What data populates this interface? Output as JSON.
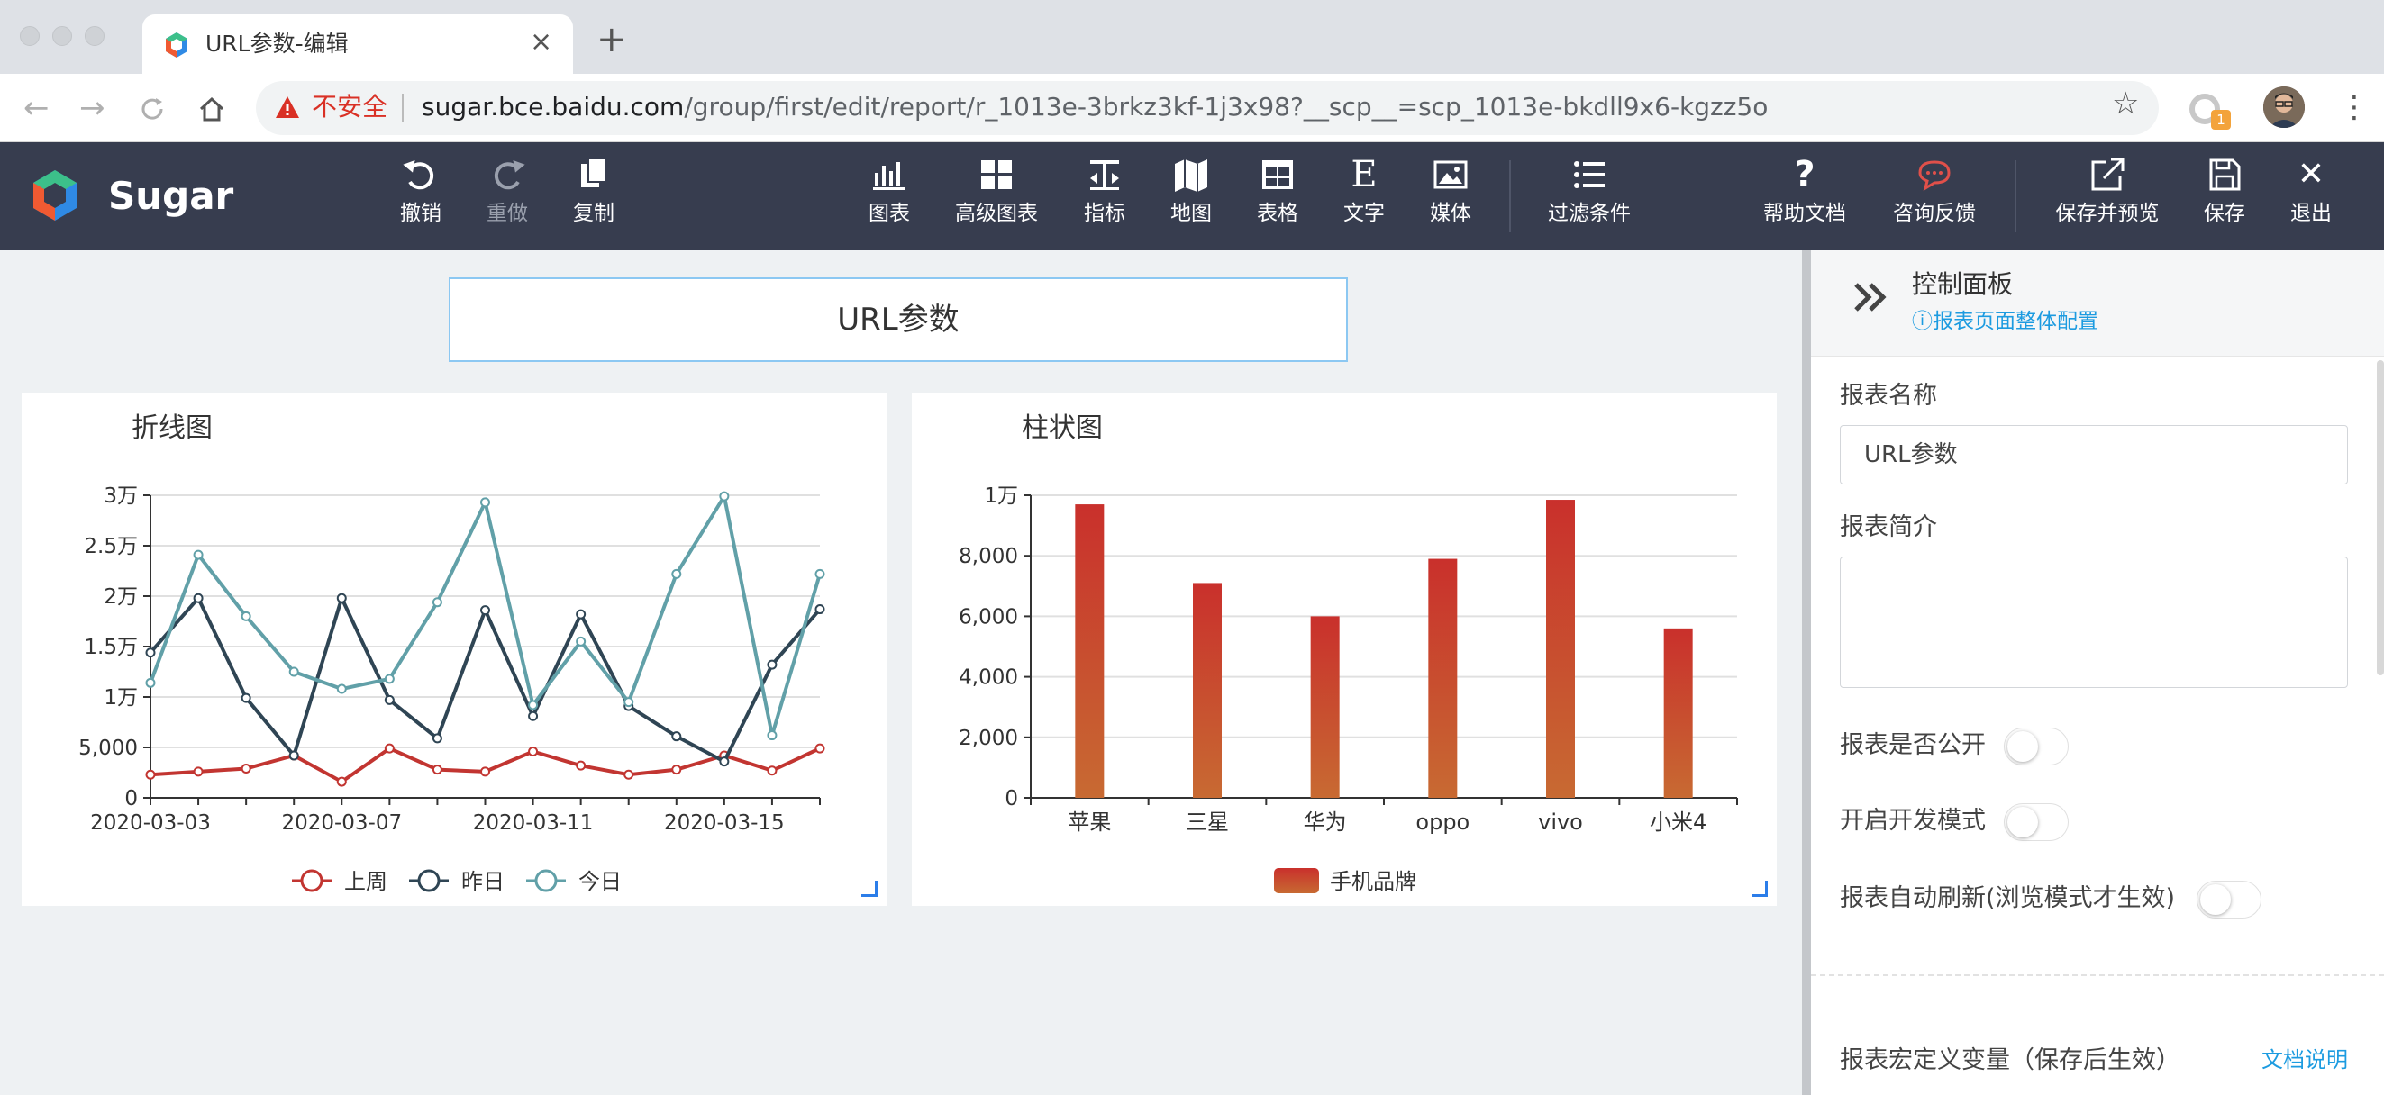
{
  "browser": {
    "tab_title": "URL参数-编辑",
    "new_tab": "+",
    "close": "×",
    "security_label": "不安全",
    "url_host": "sugar.bce.baidu.com",
    "url_path": "/group/first/edit/report/r_1013e-3brkz3kf-1j3x98?__scp__=scp_1013e-bkdll9x6-kgzz5o",
    "extension_badge": "1"
  },
  "app": {
    "brand": "Sugar",
    "tools_left": [
      {
        "label": "撤销",
        "icon": "undo-icon"
      },
      {
        "label": "重做",
        "icon": "redo-icon"
      },
      {
        "label": "复制",
        "icon": "copy-icon"
      }
    ],
    "tools_center": [
      {
        "label": "图表",
        "icon": "chart-icon"
      },
      {
        "label": "高级图表",
        "icon": "grid-chart-icon"
      },
      {
        "label": "指标",
        "icon": "metric-icon"
      },
      {
        "label": "地图",
        "icon": "map-icon"
      },
      {
        "label": "表格",
        "icon": "table-icon"
      },
      {
        "label": "文字",
        "icon": "text-icon",
        "glyph": "E"
      },
      {
        "label": "媒体",
        "icon": "image-icon"
      },
      {
        "label": "过滤条件",
        "icon": "filter-list-icon"
      }
    ],
    "tools_right": [
      {
        "label": "帮助文档",
        "icon": "help-icon",
        "glyph": "?"
      },
      {
        "label": "咨询反馈",
        "icon": "chat-icon"
      },
      {
        "label": "保存并预览",
        "icon": "external-link-icon"
      },
      {
        "label": "保存",
        "icon": "save-icon"
      },
      {
        "label": "退出",
        "icon": "close-icon",
        "glyph": "✕"
      }
    ]
  },
  "report": {
    "title": "URL参数"
  },
  "line_card": {
    "title": "折线图"
  },
  "bar_card": {
    "title": "柱状图"
  },
  "chart_data": [
    {
      "type": "line",
      "title": "折线图",
      "x": [
        "2020-03-03",
        "2020-03-04",
        "2020-03-05",
        "2020-03-06",
        "2020-03-07",
        "2020-03-08",
        "2020-03-09",
        "2020-03-10",
        "2020-03-11",
        "2020-03-12",
        "2020-03-13",
        "2020-03-14",
        "2020-03-15",
        "2020-03-16",
        "2020-03-17"
      ],
      "xtick_labels": [
        "2020-03-03",
        "2020-03-07",
        "2020-03-11",
        "2020-03-15"
      ],
      "ytick_labels": [
        "0",
        "5,000",
        "1万",
        "1.5万",
        "2万",
        "2.5万",
        "3万"
      ],
      "ylim": [
        0,
        30000
      ],
      "series": [
        {
          "name": "上周",
          "color": "#c23531",
          "values": [
            2300,
            2600,
            2900,
            4200,
            1600,
            4900,
            2800,
            2600,
            4600,
            3200,
            2300,
            2800,
            4200,
            2700,
            4900
          ]
        },
        {
          "name": "昨日",
          "color": "#2f4554",
          "values": [
            14400,
            19800,
            9900,
            4200,
            19800,
            9700,
            5900,
            18600,
            8100,
            18200,
            9100,
            6100,
            3600,
            13200,
            18700
          ]
        },
        {
          "name": "今日",
          "color": "#61a0a8",
          "values": [
            11400,
            24100,
            18000,
            12500,
            10800,
            11800,
            19400,
            29300,
            9200,
            15500,
            9500,
            22200,
            29900,
            6200,
            22200
          ]
        }
      ],
      "legend_position": "bottom",
      "grid": true
    },
    {
      "type": "bar",
      "title": "柱状图",
      "categories": [
        "苹果",
        "三星",
        "华为",
        "oppo",
        "vivo",
        "小米4"
      ],
      "series": [
        {
          "name": "手机品牌",
          "values": [
            9700,
            7100,
            6000,
            7900,
            9850,
            5600
          ]
        }
      ],
      "ytick_labels": [
        "0",
        "2,000",
        "4,000",
        "6,000",
        "8,000",
        "1万"
      ],
      "ylim": [
        0,
        10000
      ],
      "colors": {
        "top": "#c9302c",
        "bottom": "#c86a32"
      },
      "legend_position": "bottom",
      "grid": true
    }
  ],
  "panel": {
    "title": "控制面板",
    "subtitle": "报表页面整体配置",
    "name_label": "报表名称",
    "name_value": "URL参数",
    "desc_label": "报表简介",
    "public_label": "报表是否公开",
    "dev_label": "开启开发模式",
    "refresh_label": "报表自动刷新(浏览模式才生效)",
    "macro_label": "报表宏定义变量（保存后生效）",
    "docs_link": "文档说明",
    "public_on": false,
    "dev_on": false,
    "refresh_on": false
  },
  "colors": {
    "header_bg": "#373d4f",
    "accent": "#1c9be0",
    "chat_icon": "#e0504a"
  }
}
